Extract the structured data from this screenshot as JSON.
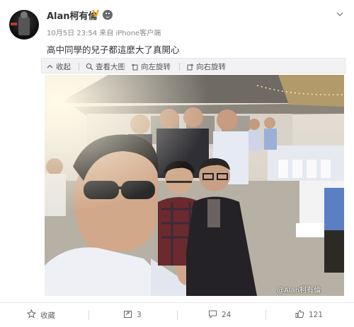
{
  "header": {
    "username": "Alan柯有倫",
    "badge": "V",
    "time": "10月5日 23:54",
    "source": "来自 iPhone客户端"
  },
  "post": {
    "text": "高中同學的兒子都這麼大了真開心"
  },
  "toolbar": {
    "collapse_label": "收起",
    "view_large_label": "查看大图",
    "rotate_left_label": "向左旋转",
    "rotate_right_label": "向右旋转"
  },
  "image": {
    "watermark": "@Alan柯有倫"
  },
  "footer": {
    "favorite_label": "收藏",
    "repost_count": "3",
    "comment_count": "24",
    "like_count": "121"
  }
}
